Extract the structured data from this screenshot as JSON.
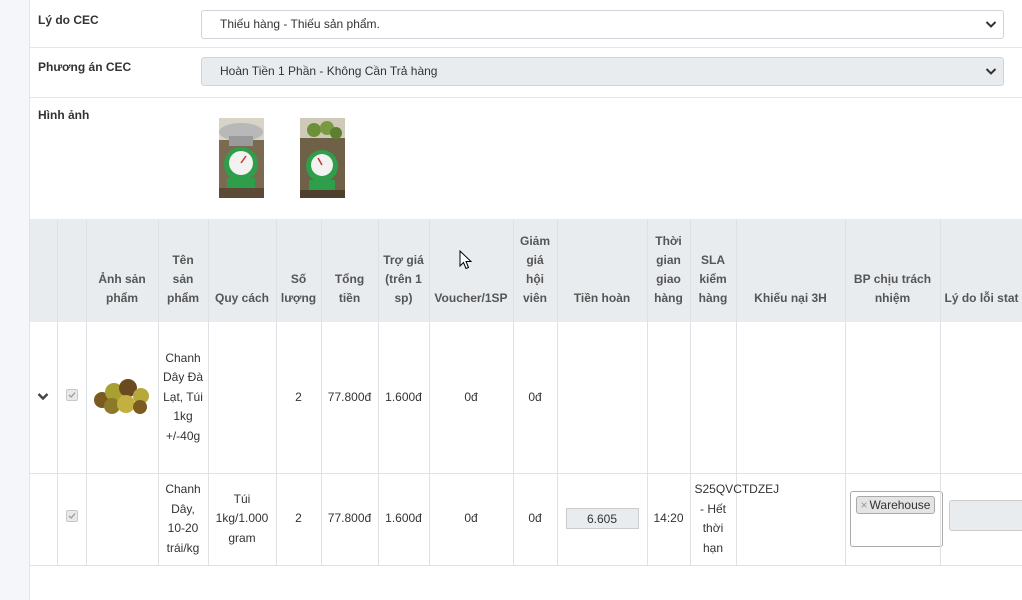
{
  "cec_reason": {
    "label": "Lý do CEC",
    "value": "Thiếu hàng - Thiếu sản phẩm."
  },
  "cec_plan": {
    "label": "Phương án CEC",
    "value": "Hoàn Tiền 1 Phần - Không Cần Trả hàng"
  },
  "images": {
    "label": "Hình ảnh"
  },
  "table": {
    "headers": {
      "product_image": "Ảnh sản phẩm",
      "product_name": "Tên sản phẩm",
      "spec": "Quy cách",
      "quantity": "Số lượng",
      "total": "Tổng tiền",
      "subsidy": "Trợ giá (trên 1 sp)",
      "voucher": "Voucher/1SP",
      "member_discount": "Giảm giá hội viên",
      "refund": "Tiền hoàn",
      "delivery_time": "Thời gian giao hàng",
      "sla": "SLA kiểm hàng",
      "complaint_3h": "Khiếu nại 3H",
      "responsible_dept": "BP chịu trách nhiệm",
      "error_reason": "Lý do lỗi stat"
    },
    "rows": [
      {
        "name": "Chanh Dây Đà Lạt, Túi 1kg +/-40g",
        "spec": "",
        "quantity": "2",
        "total": "77.800đ",
        "subsidy": "1.600đ",
        "voucher": "0đ",
        "member_discount": "0đ",
        "refund": "",
        "delivery_time": "",
        "sla": "",
        "complaint_3h": ""
      },
      {
        "name": "Chanh Dây, 10-20 trái/kg",
        "spec": "Túi 1kg/1.000 gram",
        "quantity": "2",
        "total": "77.800đ",
        "subsidy": "1.600đ",
        "voucher": "0đ",
        "member_discount": "0đ",
        "refund": "6.605",
        "delivery_time": "14:20",
        "sla": "S25QVCTDZEJ - Hết thời hạn",
        "complaint_3h": "",
        "responsible_dept_tag": "Warehouse"
      }
    ]
  },
  "colors": {
    "header_bg": "#e9ecef",
    "disabled_bg": "#e9ecef",
    "border": "#dee2e6",
    "accent_green": "#2e9e4a"
  },
  "icons": {
    "expand": "chevron-down-icon",
    "dropdown": "chevron-down-icon",
    "tag_remove": "close-icon"
  }
}
